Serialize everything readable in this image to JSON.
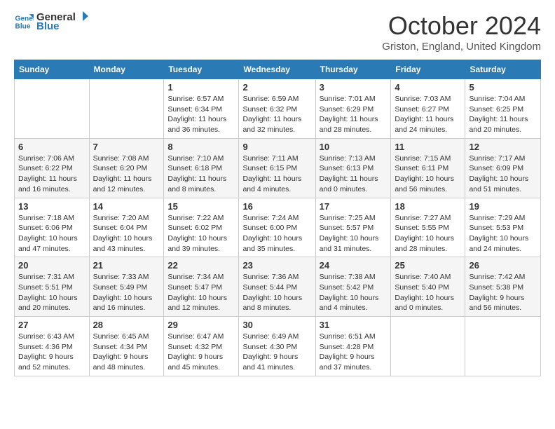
{
  "logo": {
    "line1": "General",
    "line2": "Blue"
  },
  "title": "October 2024",
  "location": "Griston, England, United Kingdom",
  "days_of_week": [
    "Sunday",
    "Monday",
    "Tuesday",
    "Wednesday",
    "Thursday",
    "Friday",
    "Saturday"
  ],
  "weeks": [
    [
      {
        "day": "",
        "sunrise": "",
        "sunset": "",
        "daylight": ""
      },
      {
        "day": "",
        "sunrise": "",
        "sunset": "",
        "daylight": ""
      },
      {
        "day": "1",
        "sunrise": "Sunrise: 6:57 AM",
        "sunset": "Sunset: 6:34 PM",
        "daylight": "Daylight: 11 hours and 36 minutes."
      },
      {
        "day": "2",
        "sunrise": "Sunrise: 6:59 AM",
        "sunset": "Sunset: 6:32 PM",
        "daylight": "Daylight: 11 hours and 32 minutes."
      },
      {
        "day": "3",
        "sunrise": "Sunrise: 7:01 AM",
        "sunset": "Sunset: 6:29 PM",
        "daylight": "Daylight: 11 hours and 28 minutes."
      },
      {
        "day": "4",
        "sunrise": "Sunrise: 7:03 AM",
        "sunset": "Sunset: 6:27 PM",
        "daylight": "Daylight: 11 hours and 24 minutes."
      },
      {
        "day": "5",
        "sunrise": "Sunrise: 7:04 AM",
        "sunset": "Sunset: 6:25 PM",
        "daylight": "Daylight: 11 hours and 20 minutes."
      }
    ],
    [
      {
        "day": "6",
        "sunrise": "Sunrise: 7:06 AM",
        "sunset": "Sunset: 6:22 PM",
        "daylight": "Daylight: 11 hours and 16 minutes."
      },
      {
        "day": "7",
        "sunrise": "Sunrise: 7:08 AM",
        "sunset": "Sunset: 6:20 PM",
        "daylight": "Daylight: 11 hours and 12 minutes."
      },
      {
        "day": "8",
        "sunrise": "Sunrise: 7:10 AM",
        "sunset": "Sunset: 6:18 PM",
        "daylight": "Daylight: 11 hours and 8 minutes."
      },
      {
        "day": "9",
        "sunrise": "Sunrise: 7:11 AM",
        "sunset": "Sunset: 6:15 PM",
        "daylight": "Daylight: 11 hours and 4 minutes."
      },
      {
        "day": "10",
        "sunrise": "Sunrise: 7:13 AM",
        "sunset": "Sunset: 6:13 PM",
        "daylight": "Daylight: 11 hours and 0 minutes."
      },
      {
        "day": "11",
        "sunrise": "Sunrise: 7:15 AM",
        "sunset": "Sunset: 6:11 PM",
        "daylight": "Daylight: 10 hours and 56 minutes."
      },
      {
        "day": "12",
        "sunrise": "Sunrise: 7:17 AM",
        "sunset": "Sunset: 6:09 PM",
        "daylight": "Daylight: 10 hours and 51 minutes."
      }
    ],
    [
      {
        "day": "13",
        "sunrise": "Sunrise: 7:18 AM",
        "sunset": "Sunset: 6:06 PM",
        "daylight": "Daylight: 10 hours and 47 minutes."
      },
      {
        "day": "14",
        "sunrise": "Sunrise: 7:20 AM",
        "sunset": "Sunset: 6:04 PM",
        "daylight": "Daylight: 10 hours and 43 minutes."
      },
      {
        "day": "15",
        "sunrise": "Sunrise: 7:22 AM",
        "sunset": "Sunset: 6:02 PM",
        "daylight": "Daylight: 10 hours and 39 minutes."
      },
      {
        "day": "16",
        "sunrise": "Sunrise: 7:24 AM",
        "sunset": "Sunset: 6:00 PM",
        "daylight": "Daylight: 10 hours and 35 minutes."
      },
      {
        "day": "17",
        "sunrise": "Sunrise: 7:25 AM",
        "sunset": "Sunset: 5:57 PM",
        "daylight": "Daylight: 10 hours and 31 minutes."
      },
      {
        "day": "18",
        "sunrise": "Sunrise: 7:27 AM",
        "sunset": "Sunset: 5:55 PM",
        "daylight": "Daylight: 10 hours and 28 minutes."
      },
      {
        "day": "19",
        "sunrise": "Sunrise: 7:29 AM",
        "sunset": "Sunset: 5:53 PM",
        "daylight": "Daylight: 10 hours and 24 minutes."
      }
    ],
    [
      {
        "day": "20",
        "sunrise": "Sunrise: 7:31 AM",
        "sunset": "Sunset: 5:51 PM",
        "daylight": "Daylight: 10 hours and 20 minutes."
      },
      {
        "day": "21",
        "sunrise": "Sunrise: 7:33 AM",
        "sunset": "Sunset: 5:49 PM",
        "daylight": "Daylight: 10 hours and 16 minutes."
      },
      {
        "day": "22",
        "sunrise": "Sunrise: 7:34 AM",
        "sunset": "Sunset: 5:47 PM",
        "daylight": "Daylight: 10 hours and 12 minutes."
      },
      {
        "day": "23",
        "sunrise": "Sunrise: 7:36 AM",
        "sunset": "Sunset: 5:44 PM",
        "daylight": "Daylight: 10 hours and 8 minutes."
      },
      {
        "day": "24",
        "sunrise": "Sunrise: 7:38 AM",
        "sunset": "Sunset: 5:42 PM",
        "daylight": "Daylight: 10 hours and 4 minutes."
      },
      {
        "day": "25",
        "sunrise": "Sunrise: 7:40 AM",
        "sunset": "Sunset: 5:40 PM",
        "daylight": "Daylight: 10 hours and 0 minutes."
      },
      {
        "day": "26",
        "sunrise": "Sunrise: 7:42 AM",
        "sunset": "Sunset: 5:38 PM",
        "daylight": "Daylight: 9 hours and 56 minutes."
      }
    ],
    [
      {
        "day": "27",
        "sunrise": "Sunrise: 6:43 AM",
        "sunset": "Sunset: 4:36 PM",
        "daylight": "Daylight: 9 hours and 52 minutes."
      },
      {
        "day": "28",
        "sunrise": "Sunrise: 6:45 AM",
        "sunset": "Sunset: 4:34 PM",
        "daylight": "Daylight: 9 hours and 48 minutes."
      },
      {
        "day": "29",
        "sunrise": "Sunrise: 6:47 AM",
        "sunset": "Sunset: 4:32 PM",
        "daylight": "Daylight: 9 hours and 45 minutes."
      },
      {
        "day": "30",
        "sunrise": "Sunrise: 6:49 AM",
        "sunset": "Sunset: 4:30 PM",
        "daylight": "Daylight: 9 hours and 41 minutes."
      },
      {
        "day": "31",
        "sunrise": "Sunrise: 6:51 AM",
        "sunset": "Sunset: 4:28 PM",
        "daylight": "Daylight: 9 hours and 37 minutes."
      },
      {
        "day": "",
        "sunrise": "",
        "sunset": "",
        "daylight": ""
      },
      {
        "day": "",
        "sunrise": "",
        "sunset": "",
        "daylight": ""
      }
    ]
  ]
}
